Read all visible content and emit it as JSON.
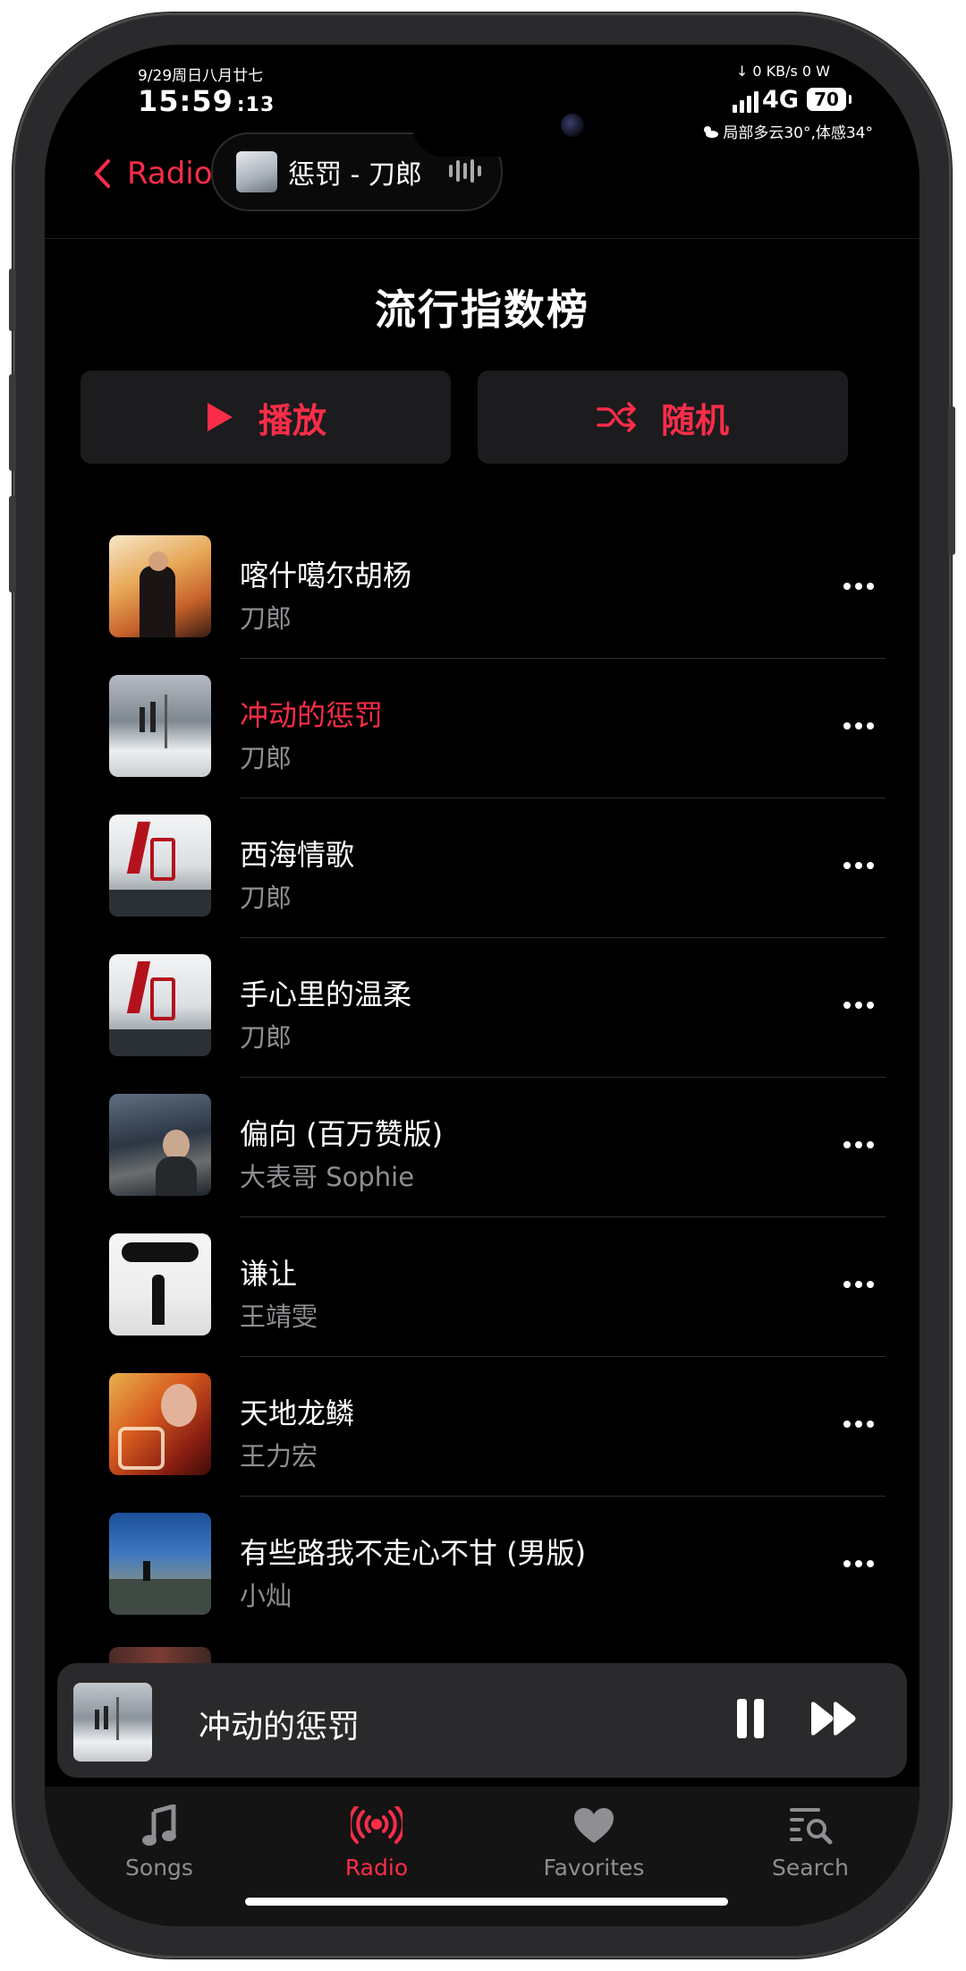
{
  "status": {
    "date": "9/29周日八月廿七",
    "time": "15:59",
    "seconds": ":13",
    "network_speed": "↓ 0 KB/s  0 W",
    "carrier": "4G",
    "battery": "70",
    "weather": "局部多云30°,体感34°"
  },
  "nav": {
    "back_label": "Radio",
    "now_playing_text": "惩罚 - 刀郎"
  },
  "page": {
    "title": "流行指数榜",
    "play_label": "播放",
    "shuffle_label": "随机"
  },
  "songs": [
    {
      "title": "喀什噶尔胡杨",
      "artist": "刀郎",
      "active": false
    },
    {
      "title": "冲动的惩罚",
      "artist": "刀郎",
      "active": true
    },
    {
      "title": "西海情歌",
      "artist": "刀郎",
      "active": false
    },
    {
      "title": "手心里的温柔",
      "artist": "刀郎",
      "active": false
    },
    {
      "title": "偏向 (百万赞版)",
      "artist": "大表哥 Sophie",
      "active": false
    },
    {
      "title": "谦让",
      "artist": "王靖雯",
      "active": false
    },
    {
      "title": "天地龙鳞",
      "artist": "王力宏",
      "active": false
    },
    {
      "title": "有些路我不走心不甘 (男版)",
      "artist": "小灿",
      "active": false
    }
  ],
  "mini_player": {
    "title": "冲动的惩罚"
  },
  "tabs": [
    {
      "label": "Songs",
      "icon": "music-note-icon",
      "active": false
    },
    {
      "label": "Radio",
      "icon": "radio-broadcast-icon",
      "active": true
    },
    {
      "label": "Favorites",
      "icon": "heart-icon",
      "active": false
    },
    {
      "label": "Search",
      "icon": "search-list-icon",
      "active": false
    }
  ],
  "colors": {
    "accent": "#fa2d48",
    "background": "#000000",
    "secondary_text": "#8e8e93"
  }
}
